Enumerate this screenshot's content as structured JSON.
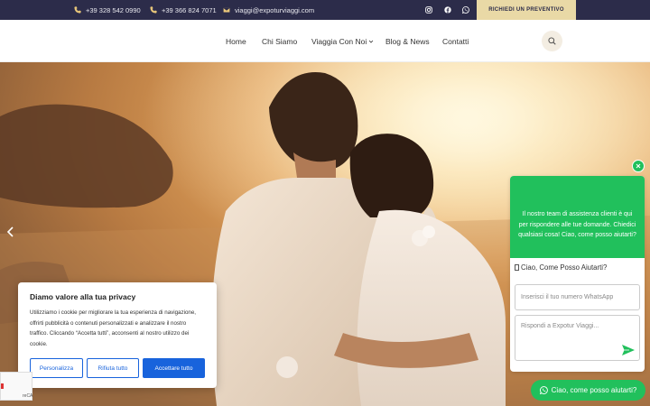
{
  "topbar": {
    "phone1": "+39 328 542 0990",
    "phone2": "+39 366 824 7071",
    "email": "viaggi@expoturviaggi.com",
    "social": [
      "instagram-icon",
      "facebook-icon",
      "whatsapp-icon"
    ],
    "cta_label": "RICHIEDI UN PREVENTIVO"
  },
  "nav": {
    "items": [
      "Home",
      "Chi Siamo",
      "Viaggia Con Noi",
      "Blog & News",
      "Contatti"
    ]
  },
  "cookie": {
    "title": "Diamo valore alla tua privacy",
    "text": "Utilizziamo i cookie per migliorare la tua esperienza di navigazione, offrirti pubblicità o contenuti personalizzati e analizzare il nostro traffico. Cliccando “Accetta tutti”, acconsenti al nostro utilizzo dei cookie.",
    "btn_customize": "Personalizza",
    "btn_reject": "Rifiuta tutto",
    "btn_accept": "Accettare tutto"
  },
  "recaptcha": {
    "label": "reCA"
  },
  "whatsapp": {
    "header_text": "Il nostro team di assistenza clienti è qui per rispondere alle tue domande. Chiedici qualsiasi cosa! Ciao, come posso aiutarti?",
    "title": "Ciao, Come Posso Aiutarti?",
    "phone_placeholder": "Inserisci il tuo numero WhatsApp",
    "message_placeholder": "Rispondi a Expotur Viaggi...",
    "bubble_label": "Ciao, come posso aiutarti?"
  },
  "colors": {
    "topbar_bg": "#2c2c4a",
    "accent_gold": "#e9c77a",
    "cta_bg": "#e9d9a6",
    "whatsapp_green": "#21c05c",
    "cookie_blue": "#1863dc"
  }
}
